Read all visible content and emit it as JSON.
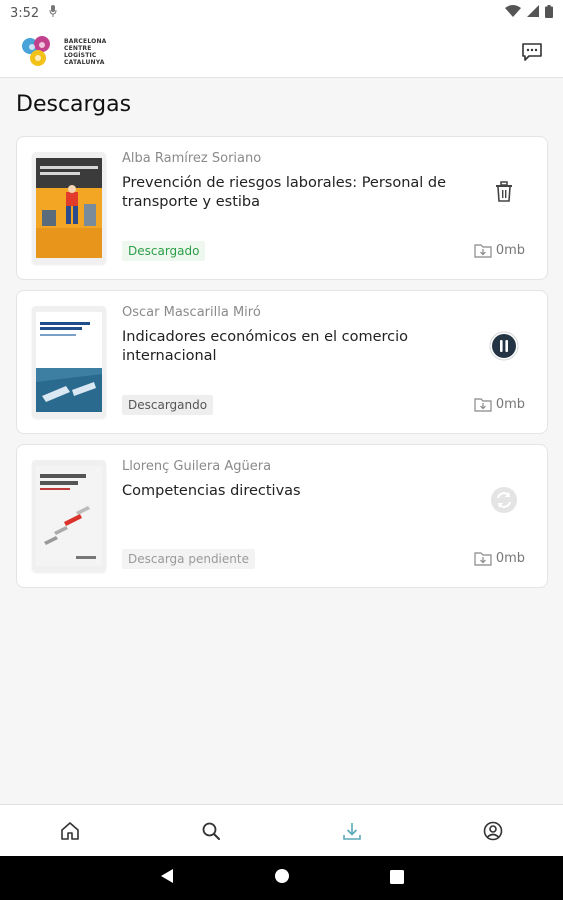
{
  "status_bar": {
    "time": "3:52"
  },
  "header": {
    "logo_lines": [
      "BARCELONA",
      "CENTRE",
      "LOGÍSTIC",
      "CATALUNYA"
    ]
  },
  "page": {
    "title": "Descargas"
  },
  "downloads": [
    {
      "author": "Alba Ramírez Soriano",
      "title": "Prevención de riesgos laborales: Personal de transporte y estiba",
      "status": "Descargado",
      "size": "0mb",
      "action_icon": "trash-icon",
      "status_color": "#2e9e4a",
      "status_bg": "#eef8ef"
    },
    {
      "author": "Oscar Mascarilla Miró",
      "title": "Indicadores económicos en el comercio internacional",
      "status": "Descargando",
      "size": "0mb",
      "action_icon": "pause-icon",
      "status_color": "#555555",
      "status_bg": "#eeeeee"
    },
    {
      "author": "Llorenç Guilera Agüera",
      "title": "Competencias directivas",
      "status": "Descarga pendiente",
      "size": "0mb",
      "action_icon": "sync-icon",
      "status_color": "#9a9a9a",
      "status_bg": "#f3f3f3"
    }
  ],
  "bottom_nav": [
    {
      "icon": "home-icon",
      "active": false
    },
    {
      "icon": "search-icon",
      "active": false
    },
    {
      "icon": "download-icon",
      "active": true
    },
    {
      "icon": "profile-icon",
      "active": false
    }
  ],
  "colors": {
    "accent": "#5aa9b7",
    "icon": "#333333"
  }
}
